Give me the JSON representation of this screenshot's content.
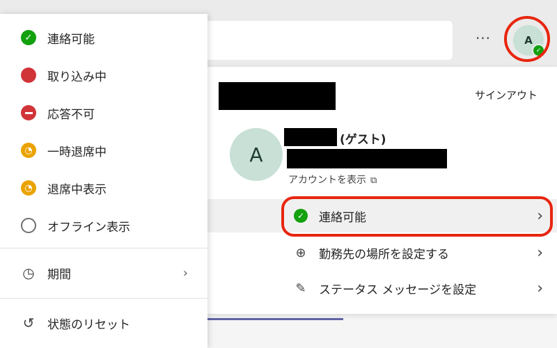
{
  "topbar": {
    "more_label": "···",
    "avatar_initial": "A"
  },
  "account": {
    "signout_label": "サインアウト",
    "profile_initial": "A",
    "guest_label": "(ゲスト)",
    "view_account_label": "アカウントを表示",
    "status_row_label": "連絡可能",
    "location_row_label": "勤務先の場所を設定する",
    "message_row_label": "ステータス メッセージを設定"
  },
  "status_menu": {
    "items": [
      {
        "label": "連絡可能",
        "icon": "check-circle-icon",
        "color": "#13a10e"
      },
      {
        "label": "取り込み中",
        "icon": "red-dot-icon",
        "color": "#d13438"
      },
      {
        "label": "応答不可",
        "icon": "minus-circle-icon",
        "color": "#d13438"
      },
      {
        "label": "一時退席中",
        "icon": "clock-icon",
        "color": "#eaa300"
      },
      {
        "label": "退席中表示",
        "icon": "clock-icon",
        "color": "#eaa300"
      },
      {
        "label": "オフライン表示",
        "icon": "x-circle-icon",
        "color": "#6e6e6e"
      }
    ],
    "duration_label": "期間",
    "reset_label": "状態のリセット"
  },
  "colors": {
    "highlight": "#e8250f",
    "available": "#13a10e",
    "busy": "#d13438",
    "away": "#eaa300"
  }
}
